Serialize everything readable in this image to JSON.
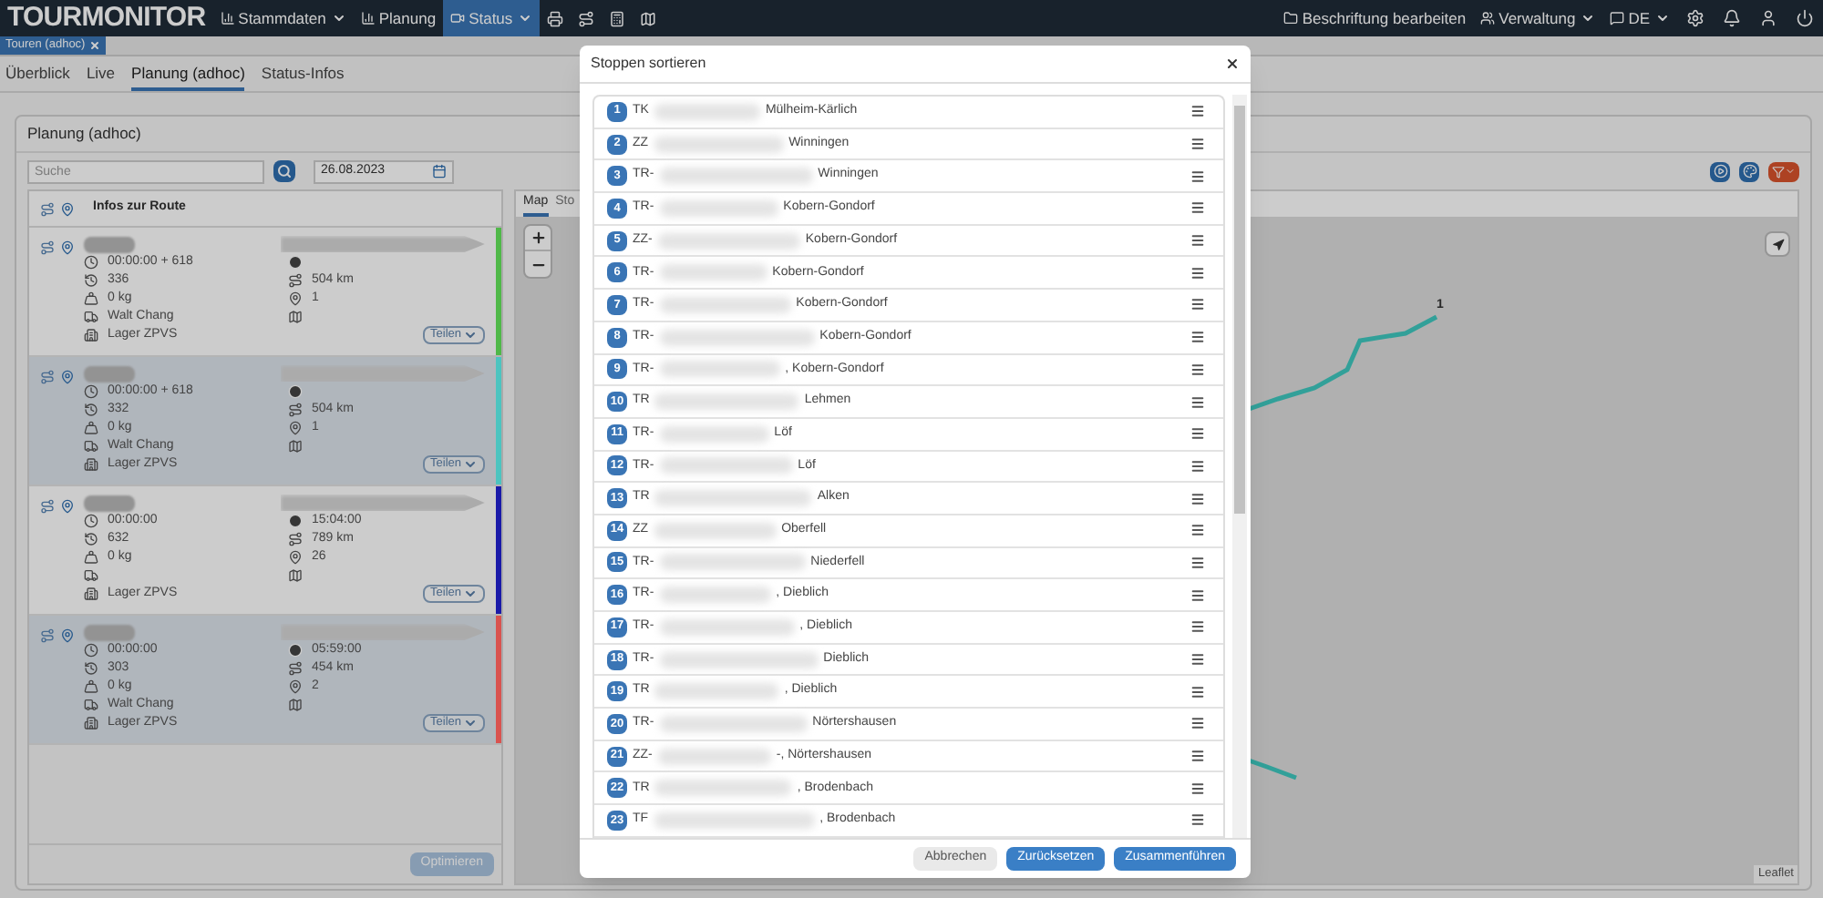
{
  "navbar": {
    "brand": "TOURMONITOR",
    "menu": [
      {
        "label": "Stammdaten",
        "dropdown": true,
        "selected": false
      },
      {
        "label": "Planung",
        "dropdown": false,
        "selected": false
      },
      {
        "label": "Status",
        "dropdown": true,
        "selected": true
      }
    ],
    "right": [
      {
        "label": "Beschriftung bearbeiten",
        "dropdown": false
      },
      {
        "label": "Verwaltung",
        "dropdown": true
      },
      {
        "label": "DE",
        "dropdown": true
      }
    ]
  },
  "open_tab": {
    "label": "Touren (adhoc)"
  },
  "subtabs": [
    {
      "label": "Überblick",
      "selected": false
    },
    {
      "label": "Live",
      "selected": false
    },
    {
      "label": "Planung (adhoc)",
      "selected": true
    },
    {
      "label": "Status-Infos",
      "selected": false
    }
  ],
  "panel": {
    "title": "Planung (adhoc)",
    "search": {
      "placeholder": "Suche"
    },
    "date": {
      "value": "26.08.2023"
    },
    "route_list": {
      "header": "Infos zur Route",
      "tours": [
        {
          "selected": false,
          "color": "#4fb848",
          "time": "00:00:00 + 618",
          "count": "336",
          "distance": "504 km",
          "weight": "0 kg",
          "stops": "1",
          "driver": "Walt Chang",
          "depot": "Lager ZPVS",
          "share": "Teilen"
        },
        {
          "selected": true,
          "color": "#4cc4c0",
          "time": "00:00:00 + 618",
          "count": "332",
          "distance": "504 km",
          "weight": "0 kg",
          "stops": "1",
          "driver": "Walt Chang",
          "depot": "Lager ZPVS",
          "share": "Teilen"
        },
        {
          "selected": false,
          "color": "#1a1aa8",
          "time": "00:00:00",
          "end_time": "15:04:00",
          "count": "632",
          "distance": "789 km",
          "weight": "0 kg",
          "stops": "26",
          "depot": "Lager ZPVS",
          "share": "Teilen"
        },
        {
          "selected": true,
          "color": "#d9534f",
          "time": "00:00:00",
          "end_time": "05:59:00",
          "count": "303",
          "distance": "454 km",
          "weight": "0 kg",
          "stops": "2",
          "driver": "Walt Chang",
          "depot": "Lager ZPVS",
          "share": "Teilen"
        }
      ],
      "optimize_button": {
        "label": "Optimieren",
        "disabled": true
      }
    },
    "map_tabs": [
      {
        "label": "Map",
        "selected": true
      },
      {
        "label": "Sto",
        "selected": false
      }
    ],
    "map": {
      "marker": "1",
      "attribution": "Leaflet"
    }
  },
  "modal": {
    "title": "Stoppen sortieren",
    "stops": [
      {
        "number": "1",
        "code": "TK",
        "place": "Mülheim-Kärlich"
      },
      {
        "number": "2",
        "code": "ZZ",
        "place": "Winningen"
      },
      {
        "number": "3",
        "code": "TR-",
        "place": "Winningen"
      },
      {
        "number": "4",
        "code": "TR-",
        "place": "Kobern-Gondorf"
      },
      {
        "number": "5",
        "code": "ZZ-",
        "place": "Kobern-Gondorf"
      },
      {
        "number": "6",
        "code": "TR-",
        "place": "Kobern-Gondorf"
      },
      {
        "number": "7",
        "code": "TR-",
        "place": "Kobern-Gondorf"
      },
      {
        "number": "8",
        "code": "TR-",
        "place": "Kobern-Gondorf"
      },
      {
        "number": "9",
        "code": "TR-",
        "place": ", Kobern-Gondorf"
      },
      {
        "number": "10",
        "code": "TR",
        "place": "Lehmen"
      },
      {
        "number": "11",
        "code": "TR-",
        "place": "Löf"
      },
      {
        "number": "12",
        "code": "TR-",
        "place": "Löf"
      },
      {
        "number": "13",
        "code": "TR",
        "place": "Alken"
      },
      {
        "number": "14",
        "code": "ZZ",
        "place": "Oberfell"
      },
      {
        "number": "15",
        "code": "TR-",
        "place": "Niederfell"
      },
      {
        "number": "16",
        "code": "TR-",
        "place": ", Dieblich"
      },
      {
        "number": "17",
        "code": "TR-",
        "place": ", Dieblich"
      },
      {
        "number": "18",
        "code": "TR-",
        "place": "Dieblich"
      },
      {
        "number": "19",
        "code": "TR",
        "place": ", Dieblich"
      },
      {
        "number": "20",
        "code": "TR-",
        "place": "Nörtershausen"
      },
      {
        "number": "21",
        "code": "ZZ-",
        "place": "-, Nörtershausen"
      },
      {
        "number": "22",
        "code": "TR",
        "place": ", Brodenbach"
      },
      {
        "number": "23",
        "code": "TF",
        "place": ", Brodenbach"
      }
    ],
    "buttons": [
      {
        "label": "Abbrechen",
        "kind": "secondary"
      },
      {
        "label": "Zurücksetzen",
        "kind": "primary"
      },
      {
        "label": "Zusammenführen",
        "kind": "primary"
      }
    ]
  }
}
